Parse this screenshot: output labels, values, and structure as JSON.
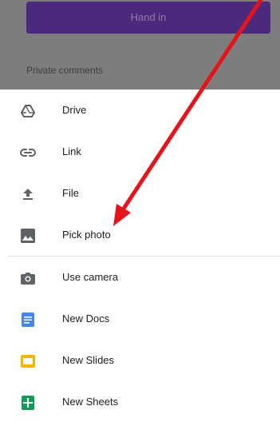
{
  "background": {
    "hand_in_label": "Hand in",
    "private_comments_label": "Private comments"
  },
  "menu": {
    "items": [
      {
        "label": "Drive",
        "icon": "drive-icon"
      },
      {
        "label": "Link",
        "icon": "link-icon"
      },
      {
        "label": "File",
        "icon": "upload-icon"
      },
      {
        "label": "Pick photo",
        "icon": "image-icon"
      },
      {
        "label": "Use camera",
        "icon": "camera-icon"
      },
      {
        "label": "New Docs",
        "icon": "docs-icon"
      },
      {
        "label": "New Slides",
        "icon": "slides-icon"
      },
      {
        "label": "New Sheets",
        "icon": "sheets-icon"
      }
    ]
  },
  "colors": {
    "overlay": "#7d7d7d",
    "hand_in_button": "#4b2a7e",
    "annotation_arrow": "#e8121b",
    "docs": "#4285f4",
    "slides": "#f4b400",
    "sheets": "#0f9d58",
    "icon_gray": "#5f6368"
  }
}
